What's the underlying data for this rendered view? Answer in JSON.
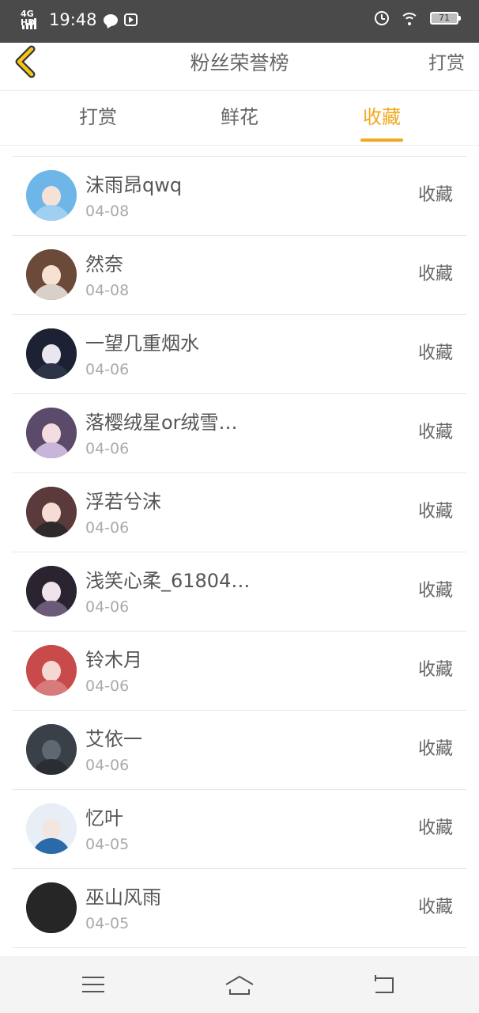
{
  "status_bar": {
    "network": "4G HD",
    "time": "19:48",
    "battery": "71"
  },
  "header": {
    "title": "粉丝荣誉榜",
    "right_action": "打赏"
  },
  "tabs": [
    {
      "label": "打赏",
      "active": false
    },
    {
      "label": "鲜花",
      "active": false
    },
    {
      "label": "收藏",
      "active": true
    }
  ],
  "accent_color": "#f2a91f",
  "fans": [
    {
      "name": "沫雨昂qwq",
      "date": "04-08",
      "action": "收藏",
      "avatar_colors": [
        "#6fb6e8",
        "#f4e2d6",
        "#9fd0f2"
      ]
    },
    {
      "name": "然奈",
      "date": "04-08",
      "action": "收藏",
      "avatar_colors": [
        "#6b4a3a",
        "#f6e1d3",
        "#d9d0c9"
      ]
    },
    {
      "name": "一望几重烟水",
      "date": "04-06",
      "action": "收藏",
      "avatar_colors": [
        "#1c2233",
        "#e9e6ef",
        "#2d3347"
      ]
    },
    {
      "name": "落樱绒星or绒雪…",
      "date": "04-06",
      "action": "收藏",
      "avatar_colors": [
        "#5b4a6a",
        "#f3dde0",
        "#c7b6d9"
      ]
    },
    {
      "name": "浮若兮沫",
      "date": "04-06",
      "action": "收藏",
      "avatar_colors": [
        "#5a3a3a",
        "#f6dcd2",
        "#2e2a2a"
      ]
    },
    {
      "name": "浅笑心柔_61804…",
      "date": "04-06",
      "action": "收藏",
      "avatar_colors": [
        "#2a2430",
        "#efe4ea",
        "#6b5a78"
      ]
    },
    {
      "name": "铃木月",
      "date": "04-06",
      "action": "收藏",
      "avatar_colors": [
        "#c94a4a",
        "#f5d8d2",
        "#d77a7a"
      ]
    },
    {
      "name": "艾依一",
      "date": "04-06",
      "action": "收藏",
      "avatar_colors": [
        "#3a4048",
        "#5f6872",
        "#2a2e33"
      ]
    },
    {
      "name": "忆叶",
      "date": "04-05",
      "action": "收藏",
      "avatar_colors": [
        "#e8eef5",
        "#f3e6de",
        "#2a6aa8"
      ]
    },
    {
      "name": "巫山风雨",
      "date": "04-05",
      "action": "收藏",
      "avatar_colors": [
        "#262626",
        "#262626",
        "#262626"
      ]
    }
  ]
}
